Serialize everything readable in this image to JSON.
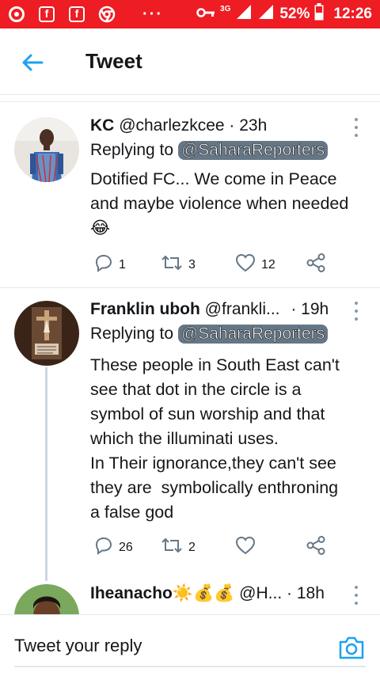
{
  "statusbar": {
    "network": "3G",
    "battery": "52%",
    "time": "12:26",
    "dots": "···"
  },
  "header": {
    "title": "Tweet"
  },
  "tweets": [
    {
      "name": "KC",
      "handle": "@charlezkcee",
      "time": "· 23h",
      "replying_label": "Replying to",
      "replying_to": "@SaharaReporters",
      "text": "Dotified FC... We come in Peace\nand maybe violence when needed\n😂",
      "replies": "1",
      "retweets": "3",
      "likes": "12"
    },
    {
      "name": "Franklin uboh",
      "handle": "@frankli...",
      "time": "· 19h",
      "replying_label": "Replying to",
      "replying_to": "@SaharaReporters",
      "text": "These people in South East can't\nsee that dot in the circle is a\nsymbol of sun worship and that\nwhich the illuminati uses.\nIn Their ignorance,they can't see\nthey are  symbolically enthroning\na false god",
      "replies": "26",
      "retweets": "2",
      "likes": ""
    },
    {
      "name": "Iheanacho",
      "emoji": "☀️💰💰",
      "handle": "@H...",
      "time": "· 18h"
    }
  ],
  "reply_bar": {
    "placeholder": "Tweet your reply"
  },
  "colors": {
    "status_bar": "#ee1c23",
    "accent": "#1da1f2",
    "icon_gray": "#657786"
  }
}
